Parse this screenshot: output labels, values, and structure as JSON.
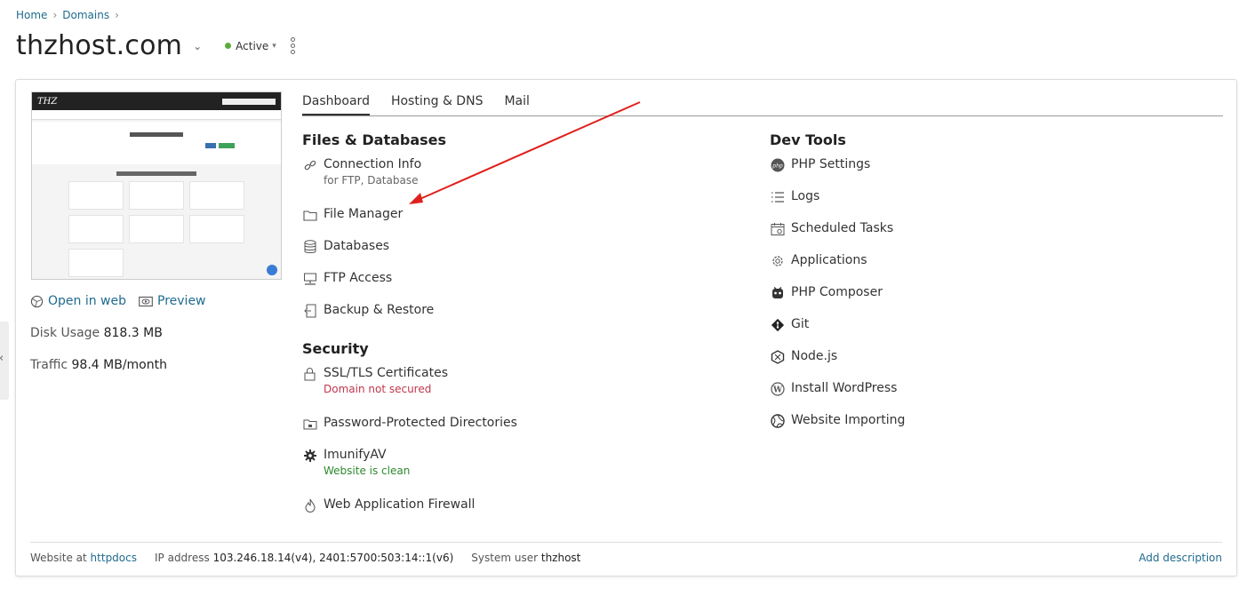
{
  "breadcrumb": {
    "home": "Home",
    "domains": "Domains"
  },
  "domain": {
    "name": "thzhost.com",
    "status": "Active",
    "status_color": "#5bab3c"
  },
  "preview": {
    "open_in_web": "Open in web",
    "preview": "Preview"
  },
  "stats": {
    "disk_label": "Disk Usage",
    "disk_value": "818.3 MB",
    "traffic_label": "Traffic",
    "traffic_value": "98.4 MB/month"
  },
  "tabs": [
    {
      "label": "Dashboard",
      "active": true
    },
    {
      "label": "Hosting & DNS"
    },
    {
      "label": "Mail"
    }
  ],
  "files": {
    "title": "Files & Databases",
    "items": [
      {
        "label": "Connection Info",
        "sub": "for FTP, Database",
        "icon": "link-icon"
      },
      {
        "label": "File Manager",
        "icon": "folder-icon"
      },
      {
        "label": "Databases",
        "icon": "database-icon"
      },
      {
        "label": "FTP Access",
        "icon": "ftp-icon"
      },
      {
        "label": "Backup & Restore",
        "icon": "backup-icon"
      }
    ]
  },
  "security": {
    "title": "Security",
    "items": [
      {
        "label": "SSL/TLS Certificates",
        "sub": "Domain not secured",
        "icon": "certificate-icon"
      },
      {
        "label": "Password-Protected Directories",
        "icon": "locked-folder-icon"
      },
      {
        "label": "ImunifyAV",
        "sub": "Website is clean",
        "icon": "gear-shield-icon"
      },
      {
        "label": "Web Application Firewall",
        "icon": "flame-icon"
      }
    ]
  },
  "devtools": {
    "title": "Dev Tools",
    "items": [
      {
        "label": "PHP Settings",
        "icon": "php-icon"
      },
      {
        "label": "Logs",
        "icon": "list-icon"
      },
      {
        "label": "Scheduled Tasks",
        "icon": "calendar-icon"
      },
      {
        "label": "Applications",
        "icon": "gear-icon"
      },
      {
        "label": "PHP Composer",
        "icon": "composer-icon"
      },
      {
        "label": "Git",
        "icon": "git-icon"
      },
      {
        "label": "Node.js",
        "icon": "nodejs-icon"
      },
      {
        "label": "Install WordPress",
        "icon": "wordpress-icon"
      },
      {
        "label": "Website Importing",
        "icon": "globe-icon"
      }
    ]
  },
  "footer": {
    "website_at": "Website at",
    "website_link": "httpdocs",
    "ip_label": "IP address",
    "ip_value": "103.246.18.14(v4), 2401:5700:503:14::1(v6)",
    "user_label": "System user",
    "user_value": "thzhost",
    "add_description": "Add description"
  },
  "annotation": {
    "arrow_color": "#e0201c"
  }
}
